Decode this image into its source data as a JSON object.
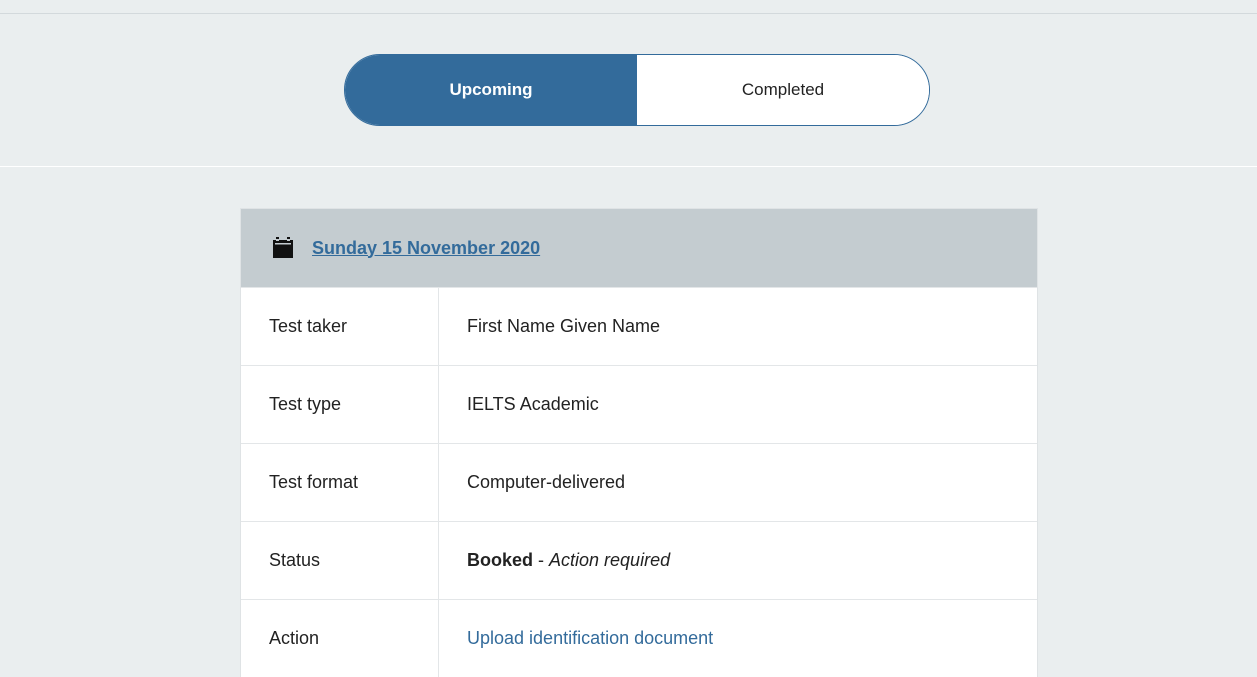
{
  "tabs": {
    "upcoming": "Upcoming",
    "completed": "Completed"
  },
  "card": {
    "icon": "calendar-icon",
    "date": "Sunday 15 November 2020",
    "rows": [
      {
        "label": "Test taker",
        "value": "First Name Given Name"
      },
      {
        "label": "Test type",
        "value": "IELTS Academic"
      },
      {
        "label": "Test format",
        "value": "Computer-delivered"
      }
    ],
    "status": {
      "label": "Status",
      "state": "Booked",
      "separator": " - ",
      "note": "Action required"
    },
    "action": {
      "label": "Action",
      "link": "Upload identification document"
    }
  },
  "colors": {
    "accent": "#336b9b",
    "page_bg": "#eaeeef",
    "header_bg": "#c4ccd0"
  }
}
